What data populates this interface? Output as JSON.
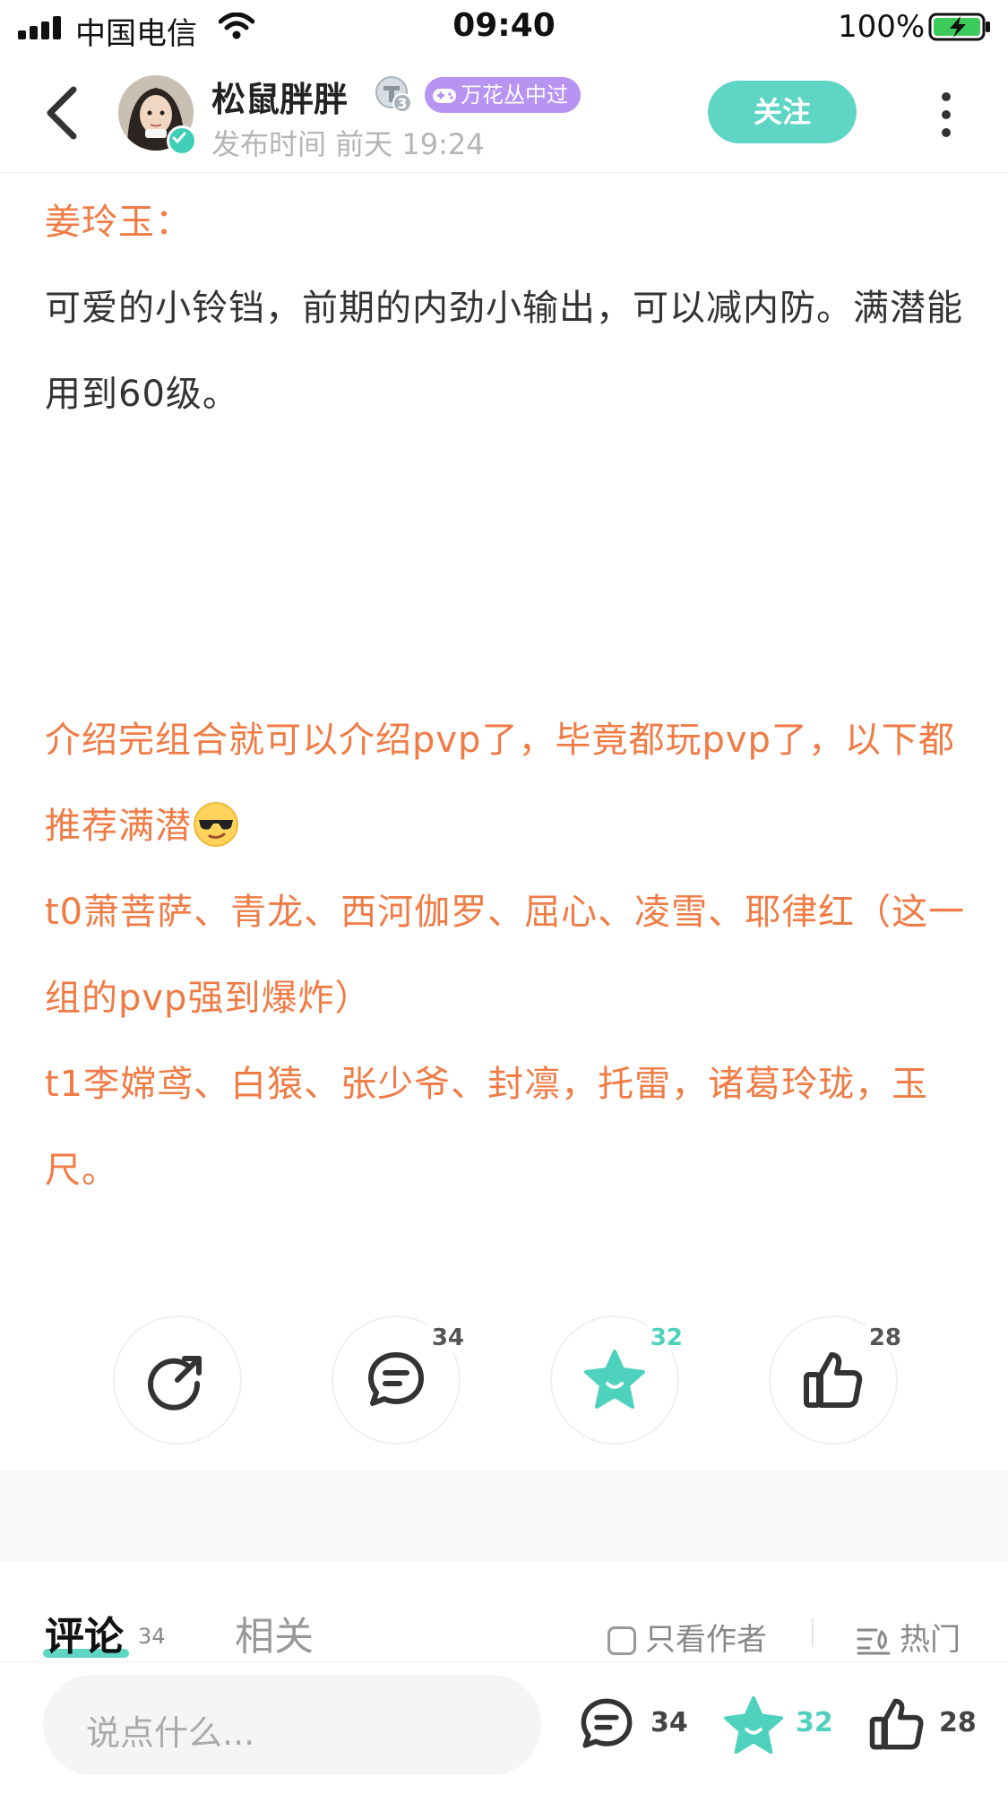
{
  "status_bar": {
    "carrier": "中国电信",
    "time": "09:40",
    "battery": "100%"
  },
  "header": {
    "author_name": "松鼠胖胖",
    "level_badge": "3",
    "game_badge": "万花丛中过",
    "publish_time": "发布时间 前天 19:24",
    "follow_label": "关注"
  },
  "post": {
    "para1_title": "姜玲玉：",
    "para1_text": "可爱的小铃铛，前期的内劲小输出，可以减内防。满潜能用到60级。",
    "para2_line1": "介绍完组合就可以介绍pvp了，毕竟都玩pvp了，以下都推荐满潜",
    "para2_line2": "t0萧菩萨、青龙、西河伽罗、屈心、凌雪、耶律红（这一组的pvp强到爆炸）",
    "para2_line3": "t1李嫦鸢、白猿、张少爷、封凛，托雷，诸葛玲珑，玉尺。"
  },
  "actions": {
    "comment_count": "34",
    "favorite_count": "32",
    "like_count": "28"
  },
  "tabs": {
    "comments_label": "评论",
    "comments_count": "34",
    "related_label": "相关",
    "author_only_label": "只看作者",
    "sort_label": "热门"
  },
  "bottom_bar": {
    "input_placeholder": "说点什么...",
    "comment_count": "34",
    "favorite_count": "32",
    "like_count": "28"
  },
  "colors": {
    "accent_teal": "#5fd6c4",
    "text_orange": "#f07b45",
    "badge_purple": "#b793f2"
  }
}
